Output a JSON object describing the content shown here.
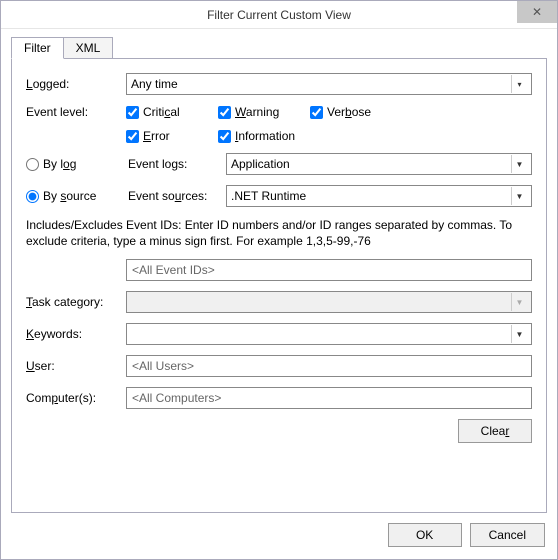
{
  "window": {
    "title": "Filter Current Custom View"
  },
  "tabs": {
    "filter": "Filter",
    "xml": "XML"
  },
  "labels": {
    "logged": "Logged:",
    "eventLevel": "Event level:",
    "byLog": "By log",
    "bySource": "By source",
    "eventLogs": "Event logs:",
    "eventSources": "Event sources:",
    "taskCategory": "Task category:",
    "keywords": "Keywords:",
    "user": "User:",
    "computers": "Computer(s):"
  },
  "logged": {
    "value": "Any time"
  },
  "levels": {
    "critical": {
      "label": "Critical",
      "checked": true
    },
    "warning": {
      "label": "Warning",
      "checked": true
    },
    "verbose": {
      "label": "Verbose",
      "checked": true
    },
    "error": {
      "label": "Error",
      "checked": true
    },
    "information": {
      "label": "Information",
      "checked": true
    }
  },
  "filterMode": "source",
  "eventLogs": {
    "value": "Application"
  },
  "eventSources": {
    "value": ".NET Runtime"
  },
  "descText": "Includes/Excludes Event IDs: Enter ID numbers and/or ID ranges separated by commas. To exclude criteria, type a minus sign first. For example 1,3,5-99,-76",
  "eventIds": {
    "value": "<All Event IDs>"
  },
  "taskCategory": {
    "value": ""
  },
  "keywords": {
    "value": ""
  },
  "user": {
    "value": "<All Users>"
  },
  "computers": {
    "value": "<All Computers>"
  },
  "buttons": {
    "clear": "Clear",
    "ok": "OK",
    "cancel": "Cancel"
  }
}
